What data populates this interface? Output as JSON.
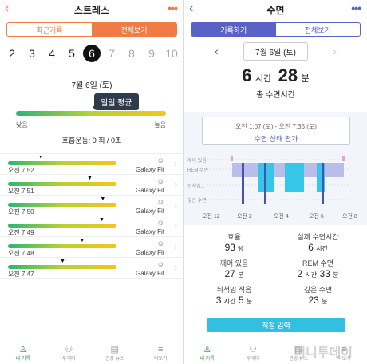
{
  "left": {
    "title": "스트레스",
    "tabs": [
      "최근기록",
      "전체보기"
    ],
    "days": [
      "2",
      "3",
      "4",
      "5",
      "6",
      "7",
      "8",
      "9",
      "10"
    ],
    "selected_day": "6",
    "date": "7월 6일 (토)",
    "tooltip": "일일 평균",
    "daily_average_level": 0.52,
    "low_label": "낮음",
    "high_label": "높음",
    "breathing": "호흡운동: 0 회 / 0초",
    "records": [
      {
        "time": "오전 7:52",
        "device": "Galaxy Fit",
        "level": 0.3
      },
      {
        "time": "오전 7:51",
        "device": "Galaxy Fit",
        "level": 0.75
      },
      {
        "time": "오전 7:50",
        "device": "Galaxy Fit",
        "level": 0.87
      },
      {
        "time": "오전 7:49",
        "device": "Galaxy Fit",
        "level": 0.86
      },
      {
        "time": "오전 7:48",
        "device": "Galaxy Fit",
        "level": 0.68
      },
      {
        "time": "오전 7:47",
        "device": "Galaxy Fit",
        "level": 0.5
      }
    ],
    "nav": [
      "내 기록",
      "투게더",
      "건강 뉴스",
      "더보기"
    ]
  },
  "right": {
    "title": "수면",
    "tabs": [
      "기록하기",
      "전체보기"
    ],
    "date": "7월 6일 (토)",
    "hours": "6",
    "hours_unit": "시간",
    "minutes": "28",
    "minutes_unit": "분",
    "total_label": "총 수면시간",
    "popup_range": "오전 1:07 (토) - 오전 7:35 (토)",
    "popup_link": "수면 상태 평가",
    "stage_labels": [
      "깨어 있음",
      "REM 수면",
      "뒤척임...",
      "깊은 수면"
    ],
    "time_labels": [
      "오전 12",
      "오전 2",
      "오전 4",
      "오전 6",
      "오전 8"
    ],
    "stats": [
      {
        "label": "효율",
        "value": "93",
        "unit": "%"
      },
      {
        "label": "실제 수면시간",
        "value": "6",
        "unit": "시간"
      },
      {
        "label": "깨어 있음",
        "value": "27",
        "unit": "분"
      },
      {
        "label": "REM 수면",
        "value": "2",
        "unit": "시간",
        "value2": "33",
        "unit2": "분"
      },
      {
        "label": "뒤척임 적음",
        "value": "3",
        "unit": "시간",
        "value2": "5",
        "unit2": "분"
      },
      {
        "label": "깊은 수면",
        "value": "23",
        "unit": "분"
      }
    ],
    "submit": "직접 입력",
    "watermark": "머니투데이",
    "nav": [
      "내 기록",
      "투게더",
      "건강 뉴스",
      "더보기"
    ]
  },
  "colors": {
    "orange": "#f07b45",
    "purple": "#5b62c7",
    "cyan": "#33c0e0",
    "green": "#2e9e47"
  }
}
